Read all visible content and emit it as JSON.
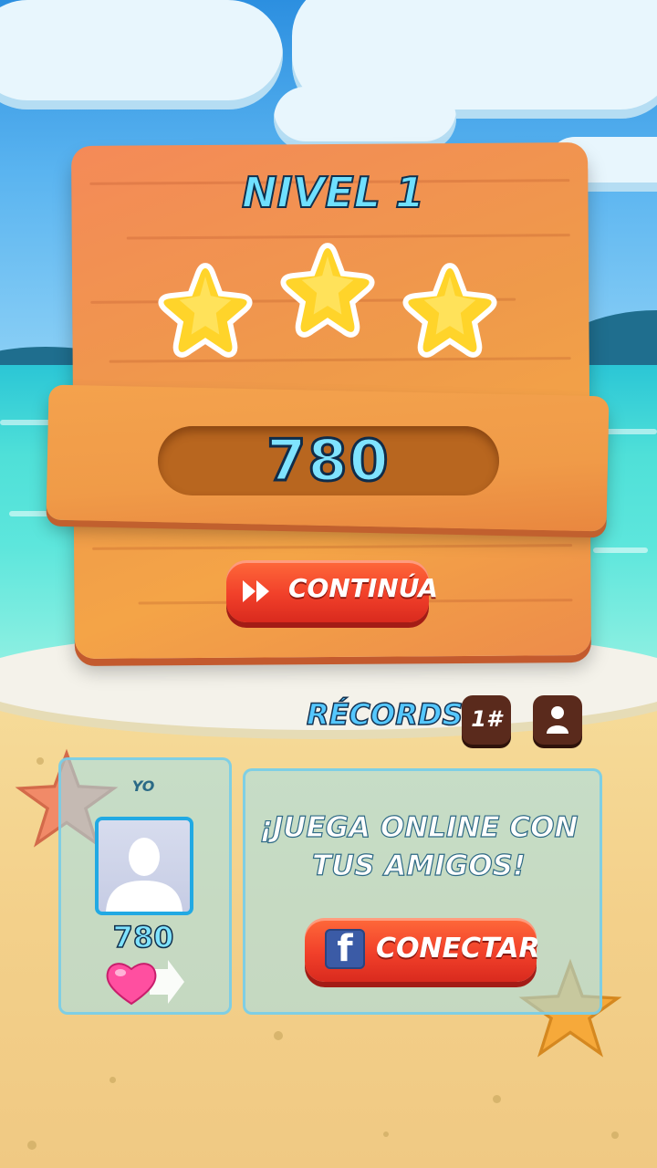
{
  "level": {
    "title": "NIVEL 1",
    "stars_earned": 3,
    "stars_total": 3
  },
  "score": {
    "value": "780"
  },
  "continue_button": {
    "label": "CONTINÚA",
    "icon": "fast-forward-icon"
  },
  "records": {
    "label": "RÉCORDS:",
    "rank_button": {
      "label": "1#"
    },
    "friends_button": {
      "icon": "person-icon"
    }
  },
  "player": {
    "name": "YO",
    "score": "780",
    "icon": "heart-arrow-icon"
  },
  "online": {
    "line1": "¡JUEGA ONLINE CON",
    "line2": "TUS AMIGOS!",
    "connect_button": {
      "label": "CONECTAR",
      "icon": "facebook-icon",
      "icon_text": "f"
    }
  },
  "colors": {
    "wood": "#ef9a4a",
    "button_red": "#f1402a",
    "title_cyan": "#6fe0ff",
    "facebook_blue": "#3b5ba6",
    "heart_pink": "#ff4fa0"
  }
}
